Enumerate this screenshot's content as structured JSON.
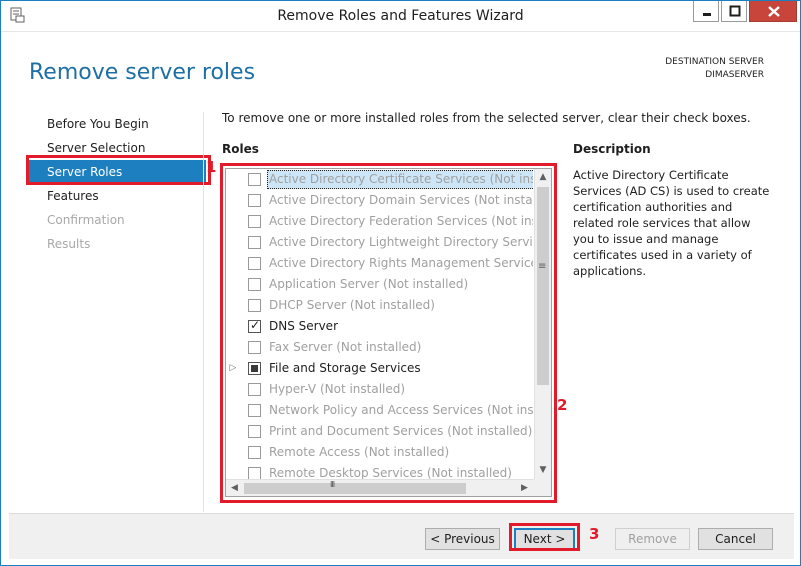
{
  "window": {
    "title": "Remove Roles and Features Wizard"
  },
  "header": {
    "title": "Remove server roles",
    "destination_label": "DESTINATION SERVER",
    "destination_value": "DIMASERVER"
  },
  "nav": {
    "items": [
      {
        "label": "Before You Begin",
        "state": "normal"
      },
      {
        "label": "Server Selection",
        "state": "normal"
      },
      {
        "label": "Server Roles",
        "state": "selected"
      },
      {
        "label": "Features",
        "state": "normal"
      },
      {
        "label": "Confirmation",
        "state": "disabled"
      },
      {
        "label": "Results",
        "state": "disabled"
      }
    ]
  },
  "annotations": {
    "marker1": "1",
    "marker2": "2",
    "marker3": "3",
    "highlight_color": "#e21b2a"
  },
  "main": {
    "instruction": "To remove one or more installed roles from the selected server, clear their check boxes.",
    "roles_label": "Roles",
    "description_label": "Description",
    "description_text": "Active Directory Certificate Services (AD CS) is used to create certification authorities and related role services that allow you to issue and manage certificates used in a variety of applications.",
    "roles": [
      {
        "label": "Active Directory Certificate Services (Not installed)",
        "checkbox": "unchecked",
        "installed": false,
        "focused": true,
        "expander": false
      },
      {
        "label": "Active Directory Domain Services (Not installed)",
        "checkbox": "unchecked",
        "installed": false,
        "focused": false,
        "expander": false
      },
      {
        "label": "Active Directory Federation Services (Not installed)",
        "checkbox": "unchecked",
        "installed": false,
        "focused": false,
        "expander": false
      },
      {
        "label": "Active Directory Lightweight Directory Services (N",
        "checkbox": "unchecked",
        "installed": false,
        "focused": false,
        "expander": false
      },
      {
        "label": "Active Directory Rights Management Services (No",
        "checkbox": "unchecked",
        "installed": false,
        "focused": false,
        "expander": false
      },
      {
        "label": "Application Server (Not installed)",
        "checkbox": "unchecked",
        "installed": false,
        "focused": false,
        "expander": false
      },
      {
        "label": "DHCP Server (Not installed)",
        "checkbox": "unchecked",
        "installed": false,
        "focused": false,
        "expander": false
      },
      {
        "label": "DNS Server",
        "checkbox": "checked",
        "installed": true,
        "focused": false,
        "expander": false
      },
      {
        "label": "Fax Server (Not installed)",
        "checkbox": "unchecked",
        "installed": false,
        "focused": false,
        "expander": false
      },
      {
        "label": "File and Storage Services",
        "checkbox": "partial",
        "installed": true,
        "focused": false,
        "expander": true
      },
      {
        "label": "Hyper-V (Not installed)",
        "checkbox": "unchecked",
        "installed": false,
        "focused": false,
        "expander": false
      },
      {
        "label": "Network Policy and Access Services (Not installed)",
        "checkbox": "unchecked",
        "installed": false,
        "focused": false,
        "expander": false
      },
      {
        "label": "Print and Document Services (Not installed)",
        "checkbox": "unchecked",
        "installed": false,
        "focused": false,
        "expander": false
      },
      {
        "label": "Remote Access (Not installed)",
        "checkbox": "unchecked",
        "installed": false,
        "focused": false,
        "expander": false
      },
      {
        "label": "Remote Desktop Services (Not installed)",
        "checkbox": "unchecked",
        "installed": false,
        "focused": false,
        "expander": false
      }
    ]
  },
  "footer": {
    "previous_label": "< Previous",
    "next_label": "Next >",
    "remove_label": "Remove",
    "cancel_label": "Cancel"
  }
}
